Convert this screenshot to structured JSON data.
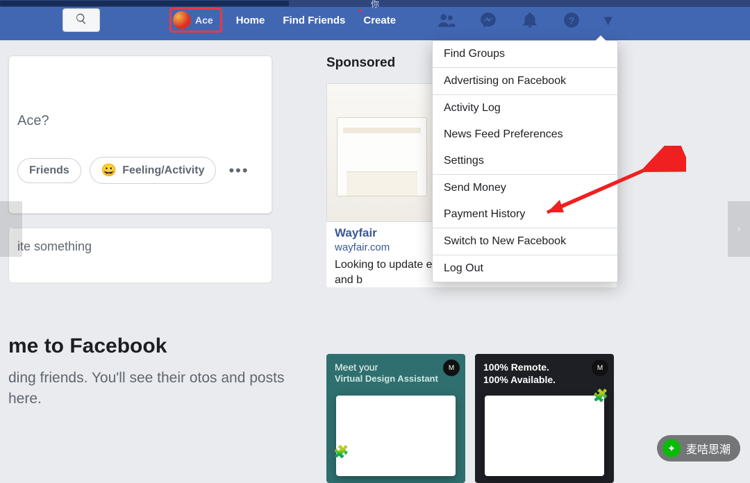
{
  "top_marker": "你",
  "nav": {
    "profile_name": "Ace",
    "home": "Home",
    "find_friends": "Find Friends",
    "create": "Create"
  },
  "dropdown": {
    "find_groups": "Find Groups",
    "advertising": "Advertising on Facebook",
    "activity_log": "Activity Log",
    "news_feed_prefs": "News Feed Preferences",
    "settings": "Settings",
    "send_money": "Send Money",
    "payment_history": "Payment History",
    "switch": "Switch to New Facebook",
    "log_out": "Log Out"
  },
  "composer": {
    "placeholder_cropped": "Ace?",
    "friends_pill": "Friends",
    "feeling_pill": "Feeling/Activity",
    "write_something": "ite something"
  },
  "welcome": {
    "heading": "me to Facebook",
    "body": "ding friends. You'll see their otos and posts here."
  },
  "sponsored": {
    "heading": "Sponsored",
    "ad1_title": "Wayfair",
    "ad1_domain": "wayfair.com",
    "ad1_desc": "Looking to update every space and b",
    "ad2_line1": "Meet your",
    "ad2_line2": "Virtual Design Assistant",
    "ad3_line1": "100% Remote.",
    "ad3_line2": "100% Available."
  },
  "watermark": "麦咭思潮"
}
